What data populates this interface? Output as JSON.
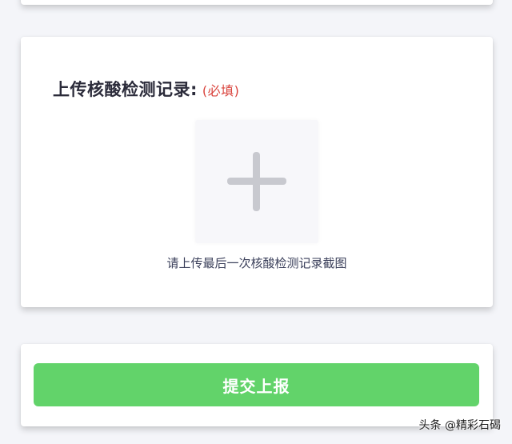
{
  "upload_section": {
    "title": "上传核酸检测记录:",
    "required": "(必填)",
    "add_icon": "plus-icon",
    "hint": "请上传最后一次核酸检测记录截图"
  },
  "submit": {
    "label": "提交上报",
    "color": "#62d36a"
  },
  "watermark": "头条 @精彩石碣",
  "colors": {
    "required": "#d9433c",
    "background": "#f4f5f9"
  }
}
